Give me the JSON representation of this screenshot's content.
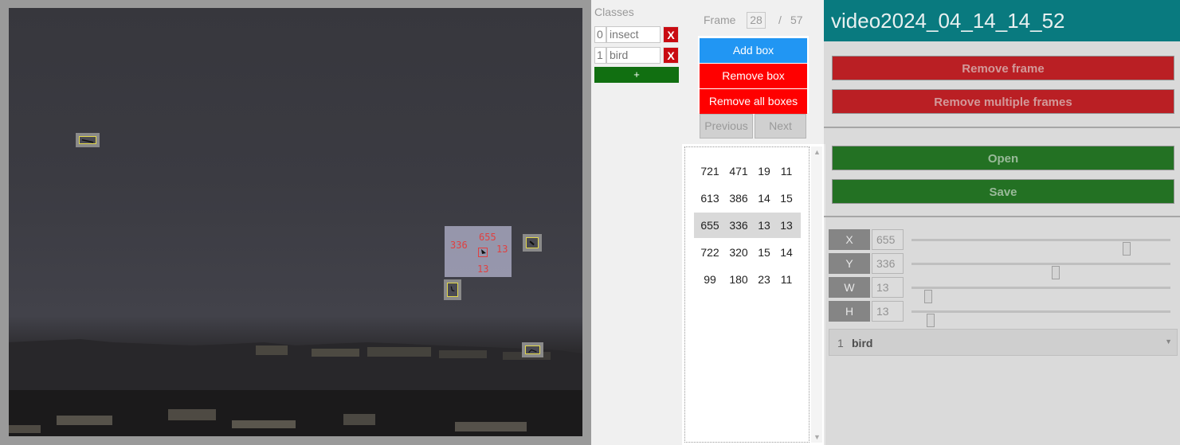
{
  "classes": {
    "title": "Classes",
    "items": [
      {
        "index": "0",
        "name": "insect",
        "delete": "X"
      },
      {
        "index": "1",
        "name": "bird",
        "delete": "X"
      }
    ],
    "add_label": "+"
  },
  "frame": {
    "label": "Frame",
    "current": "28",
    "separator": "/",
    "total": "57"
  },
  "box_buttons": {
    "add": "Add box",
    "remove": "Remove box",
    "remove_all": "Remove all boxes"
  },
  "nav": {
    "previous": "Previous",
    "next": "Next"
  },
  "boxes": [
    {
      "x": "721",
      "y": "471",
      "w": "19",
      "h": "11"
    },
    {
      "x": "613",
      "y": "386",
      "w": "14",
      "h": "15"
    },
    {
      "x": "655",
      "y": "336",
      "w": "13",
      "h": "13"
    },
    {
      "x": "722",
      "y": "320",
      "w": "15",
      "h": "14"
    },
    {
      "x": "99",
      "y": "180",
      "w": "23",
      "h": "11"
    }
  ],
  "selected_overlay": {
    "x": "655",
    "y": "336",
    "w": "13",
    "h": "13"
  },
  "video_title": "video2024_04_14_14_52",
  "actions": {
    "remove_frame": "Remove frame",
    "remove_multiple_frames": "Remove multiple frames",
    "open": "Open",
    "save": "Save"
  },
  "coords": [
    {
      "label": "X",
      "value": "655",
      "slider": 0.84
    },
    {
      "label": "Y",
      "value": "336",
      "slider": 0.56
    },
    {
      "label": "W",
      "value": "13",
      "slider": 0.05
    },
    {
      "label": "H",
      "value": "13",
      "slider": 0.06
    }
  ],
  "class_select": {
    "index": "1",
    "name": "bird"
  },
  "colors": {
    "teal": "#097a7f",
    "red": "#c90b12",
    "green": "#116f11",
    "blue": "#2196f3"
  }
}
